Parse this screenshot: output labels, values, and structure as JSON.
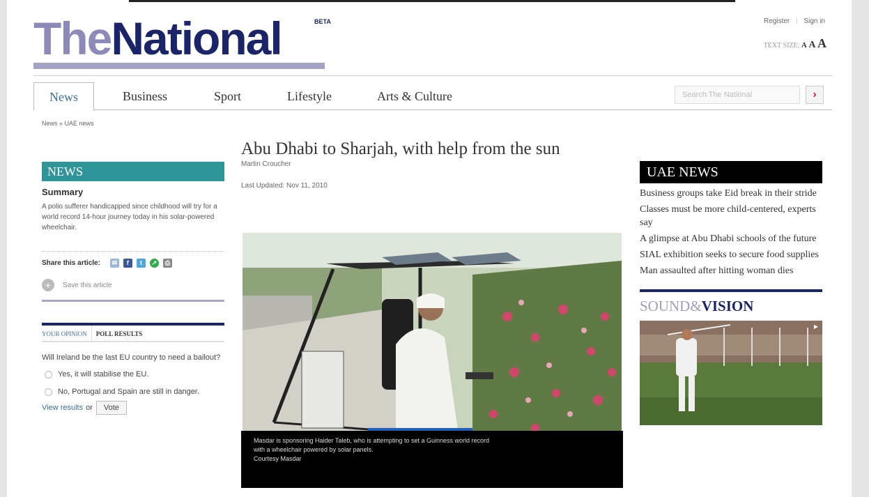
{
  "header": {
    "logo_the": "The",
    "logo_national": "National",
    "logo_beta": "BETA",
    "register": "Register",
    "sign_in": "Sign in",
    "text_size_label": "TEXT SIZE:",
    "text_size_small": "A",
    "text_size_medium": "A",
    "text_size_large": "A"
  },
  "nav": {
    "tabs": [
      {
        "label": "News"
      },
      {
        "label": "Business"
      },
      {
        "label": "Sport"
      },
      {
        "label": "Lifestyle"
      },
      {
        "label": "Arts & Culture"
      }
    ],
    "search_placeholder": "Search The National",
    "search_icon": "chevron-right-icon"
  },
  "breadcrumb": "News » UAE news",
  "left": {
    "section": "NEWS",
    "summary_title": "Summary",
    "summary_text": "A polio sufferer handicapped since childhood will try for a world record 14-hour journey today in his solar-powered wheelchair.",
    "share_label": "Share this article:",
    "save_label": "Save this article",
    "opinion_tab": "YOUR OPINION",
    "poll_tab": "POLL RESULTS",
    "question": "Will Ireland be the last EU country to need a bailout?",
    "option1": "Yes, it will stabilise the EU.",
    "option2": "No, Portugal and Spain are still in danger.",
    "view_results": "View results",
    "or": "or",
    "vote": "Vote"
  },
  "article": {
    "headline": "Abu Dhabi to Sharjah, with help from the sun",
    "author": "Martin Croucher",
    "updated": "Last Updated: Nov 11, 2010",
    "caption_line1": "Masdar is sponsoring Haider Taleb, who is attempting to set a Guinness world record",
    "caption_line2": "with a wheelchair powered by solar panels.",
    "caption_line3": "Courtesy Masdar"
  },
  "right": {
    "section": "UAE NEWS",
    "news": [
      "Business groups take Eid break in their stride",
      "Classes must be more child-centered, experts say",
      "A glimpse at Abu Dhabi schools of the future",
      "SIAL exhibition seeks to secure food supplies",
      "Man assaulted after hitting woman dies"
    ],
    "sv_sound": "SOUND&",
    "sv_vision": "VISION"
  },
  "colors": {
    "brand_navy": "#1b2468",
    "brand_lavender": "#a4a3c6",
    "news_teal": "#2f9497",
    "link_blue": "#3b6fa0"
  }
}
